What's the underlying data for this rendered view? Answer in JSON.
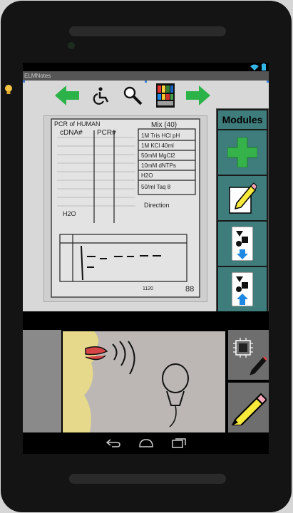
{
  "window": {
    "title": "ELMNotes"
  },
  "toolbar": {
    "back_icon": "left-arrow-icon",
    "wheelchair_icon": "wheelchair-icon",
    "search_icon": "magnifier-icon",
    "palette_icon": "color-palette-icon",
    "forward_icon": "right-arrow-icon"
  },
  "modules": {
    "title": "Modules",
    "items": [
      {
        "name": "add-module",
        "icon": "plus-icon"
      },
      {
        "name": "edit-module",
        "icon": "pencil-paper-icon"
      },
      {
        "name": "import-module",
        "icon": "shapes-arrow-down-icon"
      },
      {
        "name": "export-module",
        "icon": "shapes-arrow-up-icon"
      }
    ]
  },
  "notebook": {
    "header_left": "PCR of HUMAN",
    "col_cdna": "cDNA#",
    "col_pcr": "PCR#",
    "col_mix": "Mix (40)",
    "mix_lines": [
      "1M Tris HCl pH",
      "1M KCl  40ml",
      "50mM MgCl2",
      "10mM dNTPs",
      "H2O",
      "50/ml Taq 8"
    ],
    "water_label": "H2O",
    "direction_label": "Direction",
    "page_number": "88",
    "gel_label": "1120"
  },
  "colors": {
    "accent": "#3f7c7c",
    "arrow_green": "#2bb34a",
    "plus_green": "#35b24a",
    "pencil_yellow": "#f7ea3a"
  }
}
